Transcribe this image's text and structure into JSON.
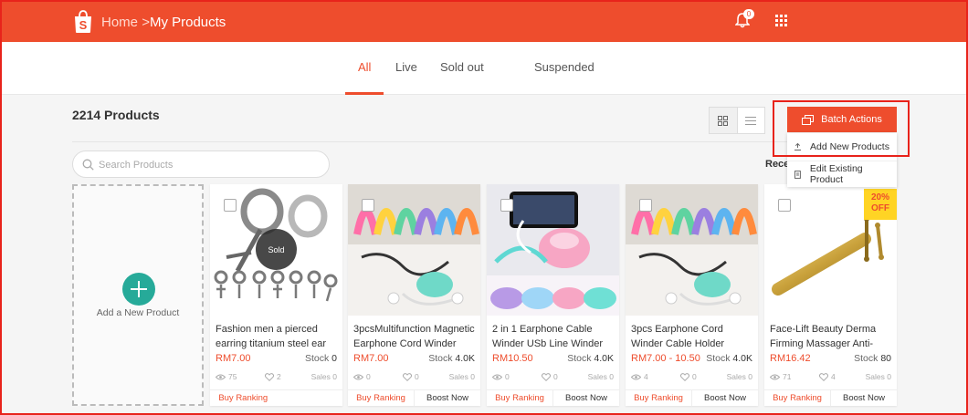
{
  "header": {
    "home": "Home",
    "separator": ">",
    "current": "My Products",
    "notification_count": "0",
    "logo_letter": "S"
  },
  "tabs": [
    {
      "label": "All",
      "active": true
    },
    {
      "label": "Live"
    },
    {
      "label": "Sold out"
    },
    {
      "label": "Suspended"
    }
  ],
  "product_count": "2214 Products",
  "search": {
    "placeholder": "Search Products"
  },
  "recent_label": "Rece",
  "batch": {
    "button": "Batch Actions",
    "menu": [
      "Add New Products",
      "Edit Existing Product"
    ]
  },
  "add_product_label": "Add a New Product",
  "colors": {
    "accent": "#ee4d2d",
    "add": "#26aa99",
    "badge": "#ffd424"
  },
  "products": [
    {
      "name": "Fashion men a pierced earring titanium steel ear",
      "price": "RM7.00",
      "stock_label": "Stock",
      "stock": "0",
      "views": "75",
      "likes": "2",
      "sales": "Sales 0",
      "badge": "Sold",
      "actions": [
        "Buy Ranking"
      ]
    },
    {
      "name": "3pcsMultifunction Magnetic Earphone Cord Winder",
      "price": "RM7.00",
      "stock_label": "Stock",
      "stock": "4.0K",
      "views": "0",
      "likes": "0",
      "sales": "Sales 0",
      "actions": [
        "Buy Ranking",
        "Boost Now"
      ]
    },
    {
      "name": "2 in 1 Earphone Cable Winder USb Line Winder",
      "price": "RM10.50",
      "stock_label": "Stock",
      "stock": "4.0K",
      "views": "0",
      "likes": "0",
      "sales": "Sales 0",
      "actions": [
        "Buy Ranking",
        "Boost Now"
      ]
    },
    {
      "name": "3pcs Earphone Cord Winder Cable Holder Organizer",
      "price": "RM7.00 - 10.50",
      "stock_label": "Stock",
      "stock": "4.0K",
      "views": "4",
      "likes": "0",
      "sales": "Sales 0",
      "actions": [
        "Buy Ranking",
        "Boost Now"
      ]
    },
    {
      "name": "Face-Lift Beauty Derma Firming Massager Anti-",
      "price": "RM16.42",
      "stock_label": "Stock",
      "stock": "80",
      "views": "71",
      "likes": "4",
      "sales": "Sales 0",
      "discount": "20% OFF",
      "actions": [
        "Buy Ranking",
        "Boost Now"
      ]
    }
  ]
}
